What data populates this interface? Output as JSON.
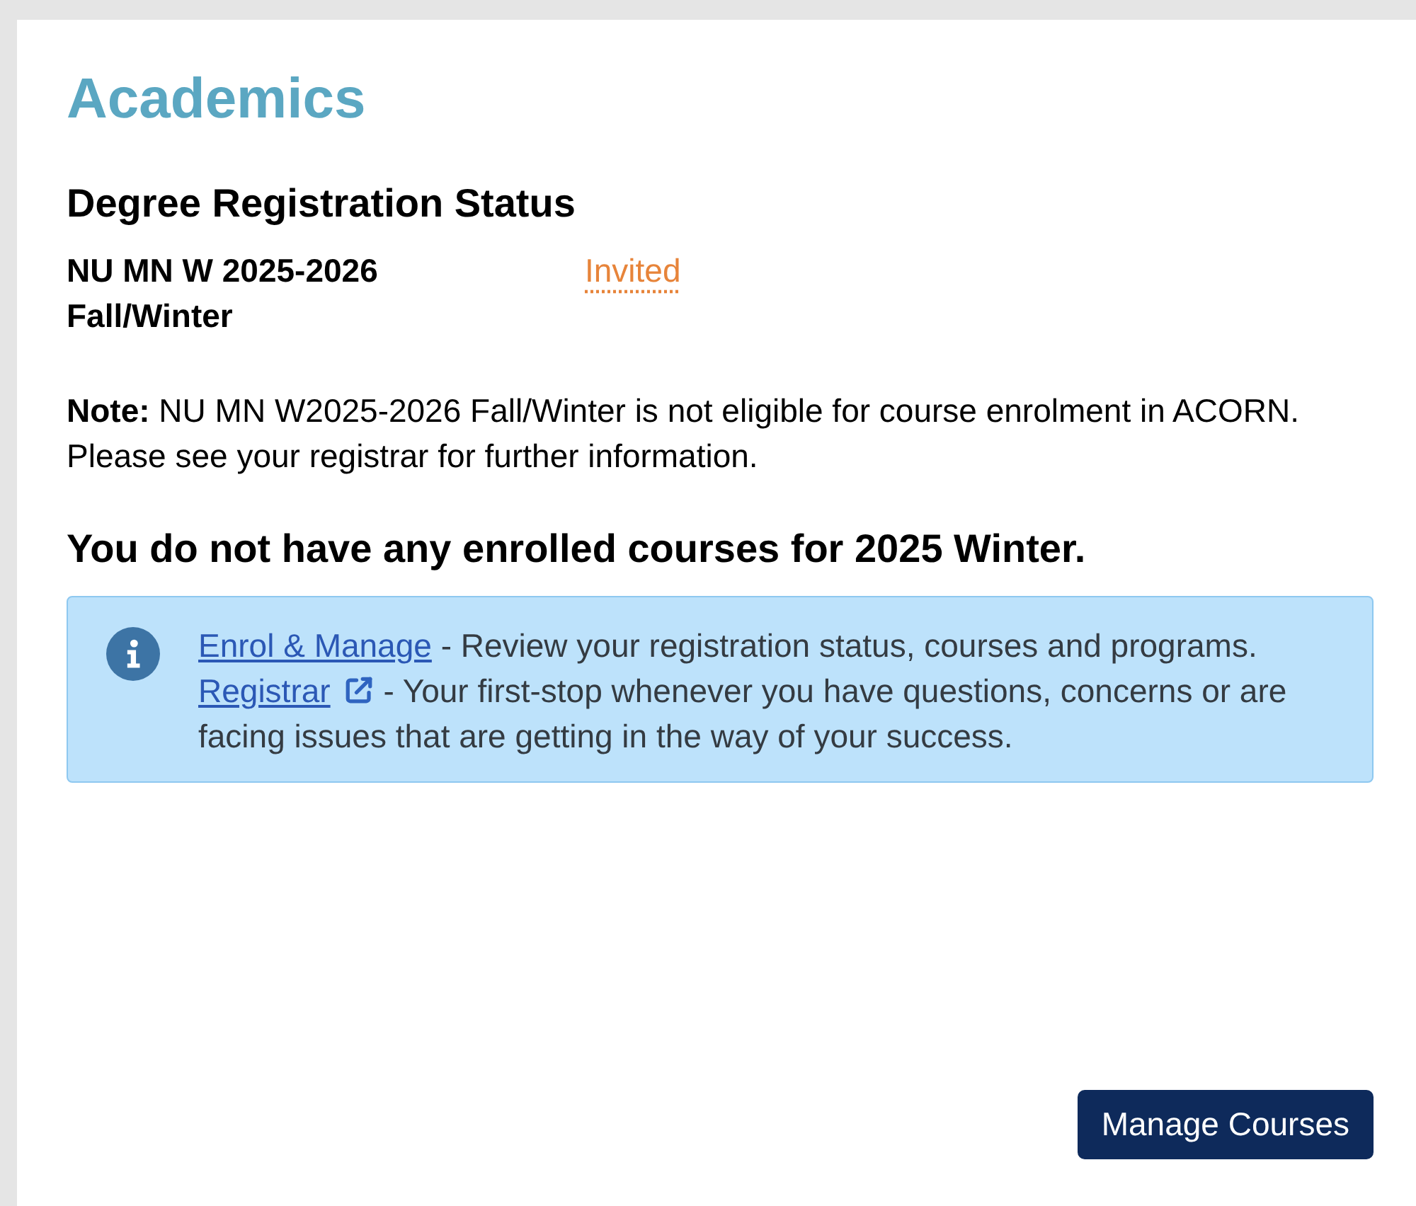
{
  "page": {
    "title": "Academics"
  },
  "degree_status": {
    "heading": "Degree Registration Status",
    "registrations": [
      {
        "program": "NU MN W 2025-2026 Fall/Winter",
        "status": "Invited"
      }
    ],
    "note": "**Note:** NU MN W2025-2026 Fall/Winter is not eligible for course enrolment in ACORN. Please see your registrar for further information."
  },
  "courses": {
    "message": "You do not have any enrolled courses for 2025 Winter."
  },
  "info_box": {
    "items": [
      {
        "link": "Enrol & Manage",
        "external": false,
        "text": "- Review your registration status, courses and programs."
      },
      {
        "link": "Registrar",
        "external": true,
        "text": "- Your first-stop whenever you have questions, concerns or are facing issues that are getting in the way of your success."
      }
    ]
  },
  "actions": {
    "buttons": [
      "Manage Courses"
    ]
  }
}
